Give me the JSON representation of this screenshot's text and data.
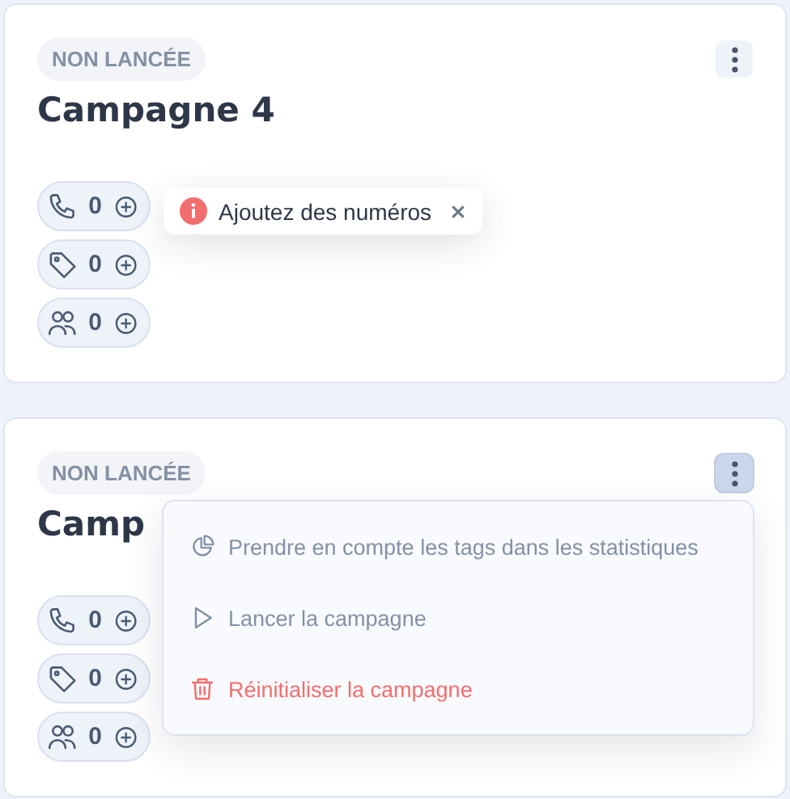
{
  "cards": [
    {
      "status": "NON LANCÉE",
      "title": "Campagne 4",
      "menu_open": false,
      "counters": [
        {
          "kind": "phone",
          "value": "0"
        },
        {
          "kind": "tag",
          "value": "0"
        },
        {
          "kind": "people",
          "value": "0"
        }
      ],
      "tooltip": {
        "text": "Ajoutez des numéros"
      }
    },
    {
      "status": "NON LANCÉE",
      "title": "Camp",
      "menu_open": true,
      "counters": [
        {
          "kind": "phone",
          "value": "0"
        },
        {
          "kind": "tag",
          "value": "0"
        },
        {
          "kind": "people",
          "value": "0"
        }
      ],
      "menu": [
        {
          "kind": "stats",
          "label": "Prendre en compte les tags dans les statistiques"
        },
        {
          "kind": "launch",
          "label": "Lancer la campagne"
        },
        {
          "kind": "reset",
          "label": "Réinitialiser la campagne"
        }
      ]
    }
  ]
}
